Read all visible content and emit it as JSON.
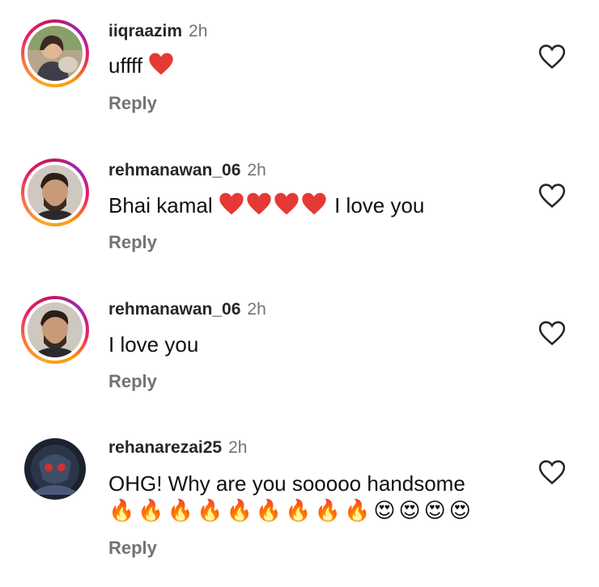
{
  "comments": [
    {
      "username": "iiqraazim",
      "time": "2h",
      "text": "uffff",
      "reply_label": "Reply"
    },
    {
      "username": "rehmanawan_06",
      "time": "2h",
      "text_before": "Bhai kamal",
      "text_after": "I love you",
      "reply_label": "Reply"
    },
    {
      "username": "rehmanawan_06",
      "time": "2h",
      "text": "I love you",
      "reply_label": "Reply"
    },
    {
      "username": "rehanarezai25",
      "time": "2h",
      "text": "OHG!  Why are you sooooo handsome",
      "emojis": [
        "🔥",
        "🔥",
        "🔥",
        "🔥",
        "🔥",
        "🔥",
        "🔥",
        "🔥",
        "🔥",
        "😍",
        "😍",
        "😍",
        "😍"
      ],
      "reply_label": "Reply"
    }
  ],
  "colors": {
    "heart_red": "#e53935",
    "secondary_text": "#737373"
  }
}
